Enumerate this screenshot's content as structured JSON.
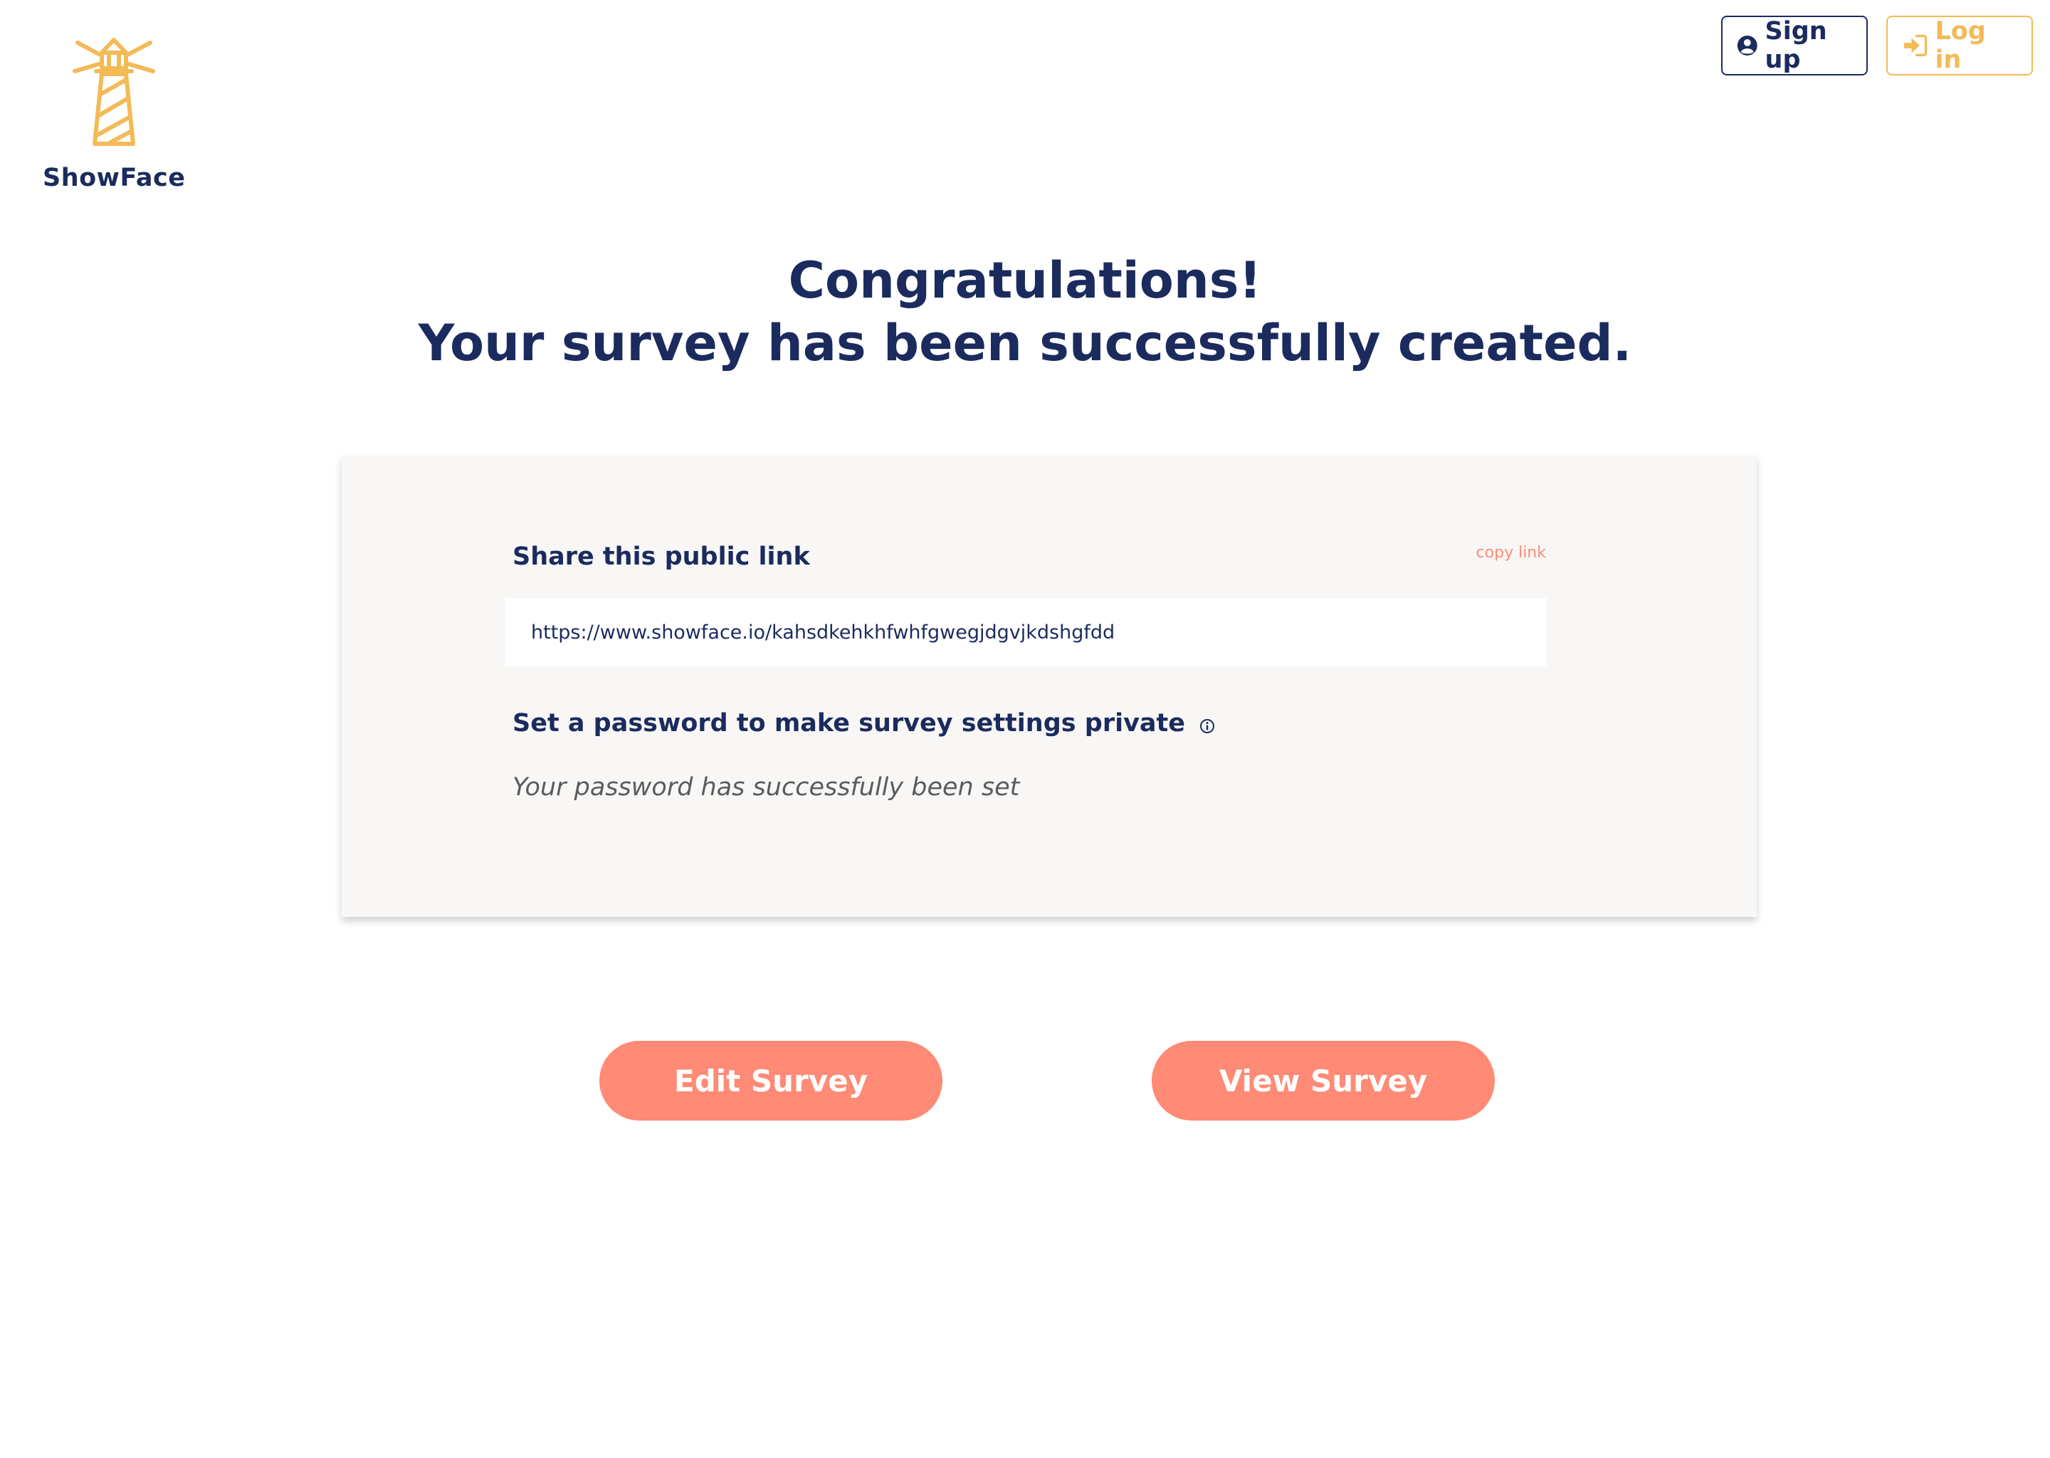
{
  "brand": {
    "name": "ShowFace",
    "logo_icon": "lighthouse-icon",
    "accent_color": "#f3ba56"
  },
  "nav": {
    "signup_label": "Sign up",
    "signup_icon": "user-circle-icon",
    "login_label": "Log in",
    "login_icon": "sign-in-icon"
  },
  "headline": {
    "line1": "Congratulations!",
    "line2": "Your survey has been successfully created."
  },
  "card": {
    "share_label": "Share this public link",
    "copy_link_label": "copy link",
    "public_link": "https://www.showface.io/kahsdkehkhfwhfgwegjdgvjkdshgfdd",
    "password_label": "Set a password to make survey settings private",
    "password_info_icon": "info-icon",
    "password_status": "Your password has successfully been set"
  },
  "actions": {
    "edit_label": "Edit Survey",
    "view_label": "View Survey",
    "button_color": "#ff8a75"
  }
}
